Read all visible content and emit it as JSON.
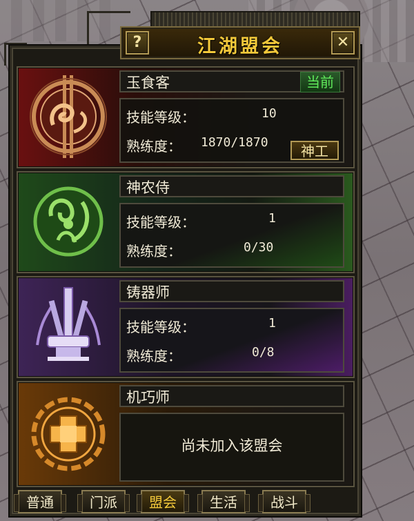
{
  "window": {
    "title": "江湖盟会",
    "help_label": "?",
    "close_label": "✕"
  },
  "professions": [
    {
      "name": "玉食客",
      "icon": "chef-emblem-icon",
      "badge": "当前",
      "skill_level_label": "技能等级：",
      "skill_level": "10",
      "proficiency_label": "熟练度：",
      "proficiency": "1870/1870",
      "title_button": "神工"
    },
    {
      "name": "神农侍",
      "icon": "herbalist-emblem-icon",
      "skill_level_label": "技能等级：",
      "skill_level": "1",
      "proficiency_label": "熟练度：",
      "proficiency": "0/30"
    },
    {
      "name": "铸器师",
      "icon": "blacksmith-emblem-icon",
      "skill_level_label": "技能等级：",
      "skill_level": "1",
      "proficiency_label": "熟练度：",
      "proficiency": "0/8"
    },
    {
      "name": "机巧师",
      "icon": "mechanic-emblem-icon",
      "status": "尚未加入该盟会"
    }
  ],
  "tabs": [
    {
      "label": "普通",
      "active": false
    },
    {
      "label": "门派",
      "active": false
    },
    {
      "label": "盟会",
      "active": true
    },
    {
      "label": "生活",
      "active": false
    },
    {
      "label": "战斗",
      "active": false
    }
  ],
  "colors": {
    "title": "#f2c83a",
    "current_badge": "#5fe85a",
    "text": "#f0ead6"
  }
}
